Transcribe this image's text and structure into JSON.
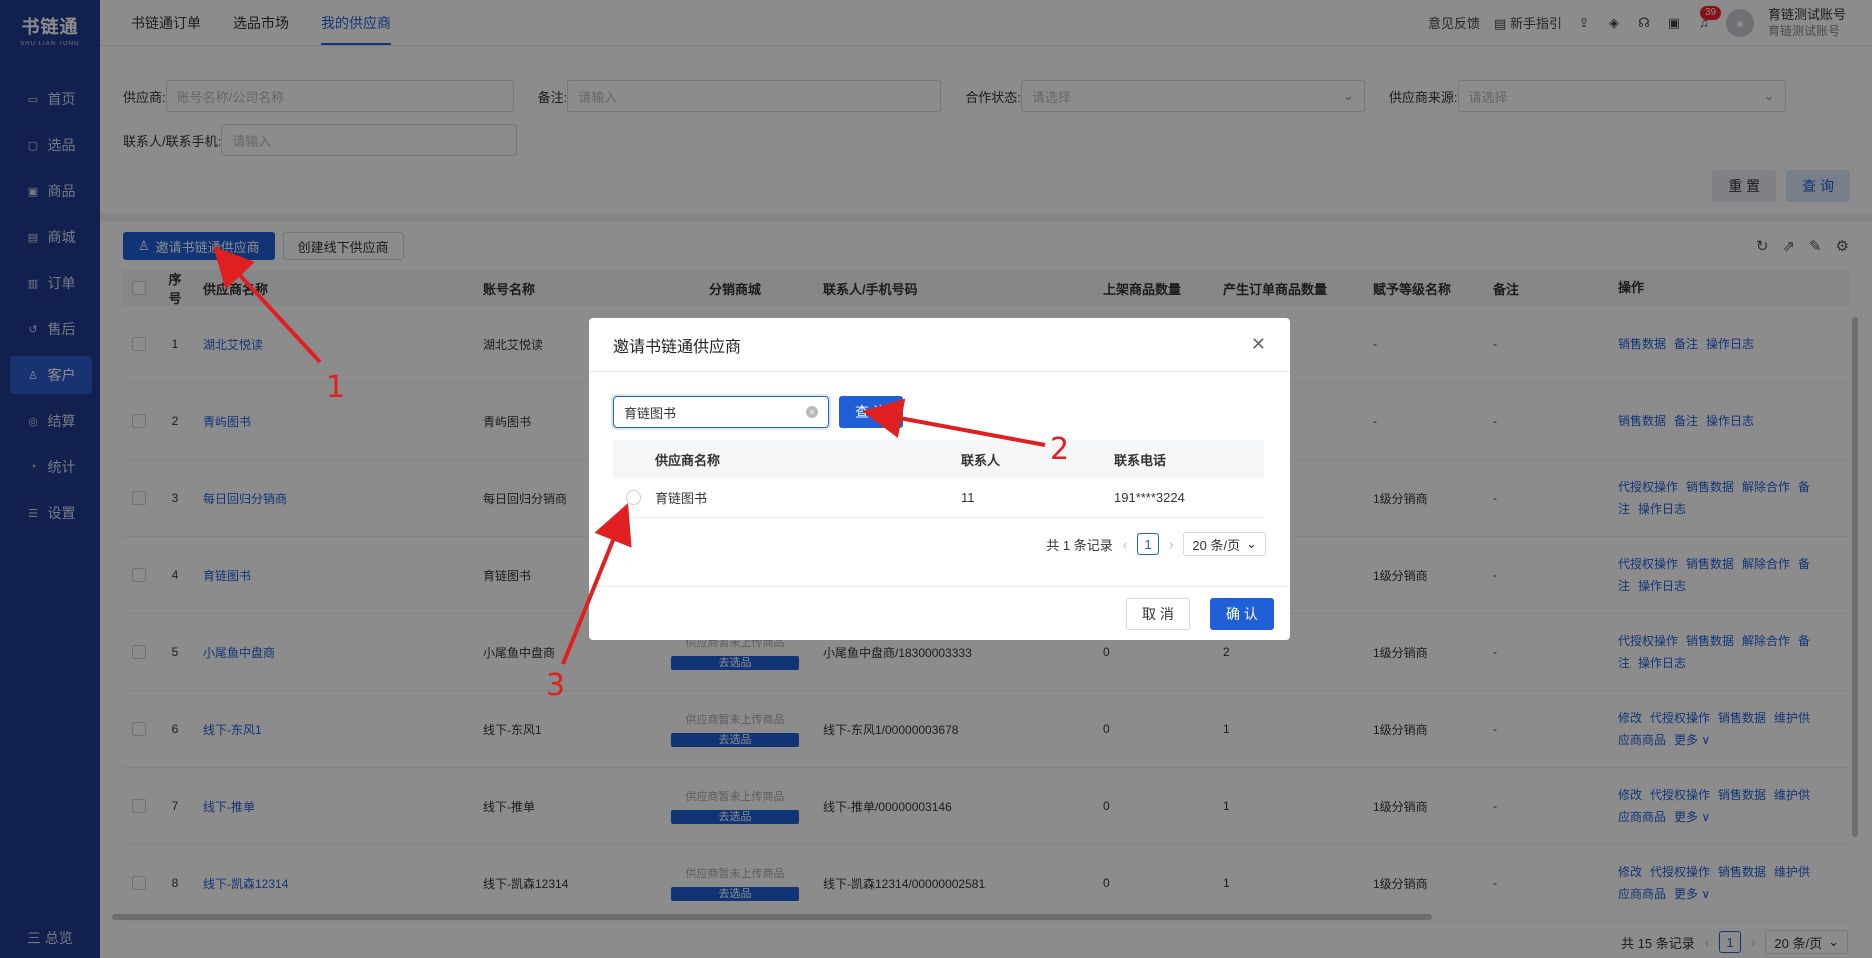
{
  "app": {
    "logo_main": "书链通",
    "logo_sub": "SHU LIAN TONG"
  },
  "sidebar": {
    "items": [
      {
        "label": "首页",
        "icon": "monitor-icon"
      },
      {
        "label": "选品",
        "icon": "select-icon"
      },
      {
        "label": "商品",
        "icon": "goods-icon"
      },
      {
        "label": "商城",
        "icon": "store-icon"
      },
      {
        "label": "订单",
        "icon": "order-icon"
      },
      {
        "label": "售后",
        "icon": "aftersale-icon"
      },
      {
        "label": "客户",
        "icon": "customer-icon",
        "active": true
      },
      {
        "label": "结算",
        "icon": "settlement-icon"
      },
      {
        "label": "统计",
        "icon": "stats-icon"
      },
      {
        "label": "设置",
        "icon": "settings-icon"
      }
    ],
    "footer": "三 总览"
  },
  "topbar": {
    "tabs": [
      "书链通订单",
      "选品市场",
      "我的供应商"
    ],
    "active_tab": 2,
    "feedback": "意见反馈",
    "guide": "新手指引",
    "notification_count": "39",
    "user_name": "育链测试账号",
    "user_sub": "育链测试账号"
  },
  "filters": {
    "supplier_label": "供应商:",
    "supplier_placeholder": "账号名称/公司名称",
    "remark_label": "备注:",
    "remark_placeholder": "请输入",
    "status_label": "合作状态:",
    "status_placeholder": "请选择",
    "source_label": "供应商来源:",
    "source_placeholder": "请选择",
    "contact_label": "联系人/联系手机:",
    "contact_placeholder": "请输入",
    "reset": "重 置",
    "query": "查 询"
  },
  "toolbar": {
    "invite_btn": "邀请书链通供应商",
    "create_btn": "创建线下供应商"
  },
  "table": {
    "headers": [
      "序号",
      "供应商名称",
      "账号名称",
      "分销商城",
      "联系人/手机号码",
      "上架商品数量",
      "产生订单商品数量",
      "赋予等级名称",
      "备注",
      "操作"
    ],
    "rows": [
      {
        "no": "1",
        "name": "湖北艾悦读",
        "account": "湖北艾悦读",
        "mall": "",
        "contact": "",
        "up": "",
        "ord": "",
        "level": "-",
        "remark": "-",
        "ops": [
          "销售数据",
          "备注",
          "操作日志"
        ]
      },
      {
        "no": "2",
        "name": "青屿图书",
        "account": "青屿图书",
        "mall": "",
        "contact": "",
        "up": "",
        "ord": "",
        "level": "-",
        "remark": "-",
        "ops": [
          "销售数据",
          "备注",
          "操作日志"
        ]
      },
      {
        "no": "3",
        "name": "每日回归分销商",
        "account": "每日回归分销商",
        "mall": "",
        "contact": "",
        "up": "",
        "ord": "",
        "level": "1级分销商",
        "remark": "-",
        "ops": [
          "代授权操作",
          "销售数据",
          "解除合作",
          "备注",
          "操作日志"
        ]
      },
      {
        "no": "4",
        "name": "育链图书",
        "account": "育链图书",
        "mall": "",
        "contact": "",
        "up": "",
        "ord": "",
        "level": "1级分销商",
        "remark": "-",
        "ops": [
          "代授权操作",
          "销售数据",
          "解除合作",
          "备注",
          "操作日志"
        ]
      },
      {
        "no": "5",
        "name": "小尾鱼中盘商",
        "account": "小尾鱼中盘商",
        "mall": "供应商暂未上传商品",
        "mall_btn": "去选品",
        "contact": "小尾鱼中盘商/18300003333",
        "up": "0",
        "ord": "2",
        "level": "1级分销商",
        "remark": "-",
        "ops": [
          "代授权操作",
          "销售数据",
          "解除合作",
          "备注",
          "操作日志"
        ]
      },
      {
        "no": "6",
        "name": "线下-东风1",
        "account": "线下-东风1",
        "mall": "供应商暂未上传商品",
        "mall_btn": "去选品",
        "contact": "线下-东风1/00000003678",
        "up": "0",
        "ord": "1",
        "level": "1级分销商",
        "remark": "-",
        "ops": [
          "修改",
          "代授权操作",
          "销售数据",
          "维护供应商商品",
          "更多 ∨"
        ]
      },
      {
        "no": "7",
        "name": "线下-推单",
        "account": "线下-推单",
        "mall": "供应商暂未上传商品",
        "mall_btn": "去选品",
        "contact": "线下-推单/00000003146",
        "up": "0",
        "ord": "1",
        "level": "1级分销商",
        "remark": "-",
        "ops": [
          "修改",
          "代授权操作",
          "销售数据",
          "维护供应商商品",
          "更多 ∨"
        ]
      },
      {
        "no": "8",
        "name": "线下-凯森12314",
        "account": "线下-凯森12314",
        "mall": "供应商暂未上传商品",
        "mall_btn": "去选品",
        "contact": "线下-凯森12314/00000002581",
        "up": "0",
        "ord": "1",
        "level": "1级分销商",
        "remark": "-",
        "ops": [
          "修改",
          "代授权操作",
          "销售数据",
          "维护供应商商品",
          "更多 ∨"
        ]
      }
    ],
    "pager_total": "共 15 条记录",
    "pager_page": "1",
    "pager_size": "20 条/页"
  },
  "modal": {
    "title": "邀请书链通供应商",
    "search_value": "育链图书",
    "search_btn": "查 询",
    "headers": [
      "供应商名称",
      "联系人",
      "联系电话"
    ],
    "rows": [
      {
        "name": "育链图书",
        "contact": "11",
        "phone": "191****3224"
      }
    ],
    "total": "共 1 条记录",
    "page": "1",
    "page_size": "20 条/页",
    "cancel": "取 消",
    "confirm": "确 认"
  },
  "annotations": [
    "1",
    "2",
    "3"
  ],
  "colors": {
    "sidebar": "#1f3b8f",
    "primary": "#1f5fd8",
    "annotation": "#e02020"
  }
}
